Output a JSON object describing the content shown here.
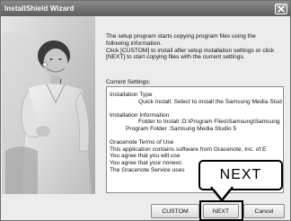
{
  "window": {
    "title": "InstallShield Wizard"
  },
  "intro": {
    "line1": "The setup program starts copying program files using the",
    "line2": "following information.",
    "line3": "Click [CUSTOM] to install after setup installation settings or click",
    "line4": "[NEXT] to start copying files with the current settings."
  },
  "settings": {
    "label": "Current Settings:",
    "install_type_heading": "Installation Type",
    "install_type_value": "Quick Install: Select to install the Samsung Media Stud",
    "install_info_heading": "Installation Information",
    "install_folder": "Folder to Install :D:\\Program Files\\Samsung\\Samsung",
    "program_folder": "Program Folder :Samsung Media Studio 5",
    "gracenote_heading": "Gracenote Terms of Use",
    "gracenote_line1": "This application contains software from Gracenote, Inc. of E",
    "gracenote_line2": "You agree that you will use",
    "gracenote_line3": "You agree that your nonexc",
    "gracenote_line4": "The Gracenote Service uses"
  },
  "buttons": {
    "custom": "CUSTOM",
    "next": "NEXT",
    "cancel": "Cancel"
  },
  "callout": {
    "text": "NEXT"
  },
  "icons": {
    "close": "close-icon"
  }
}
